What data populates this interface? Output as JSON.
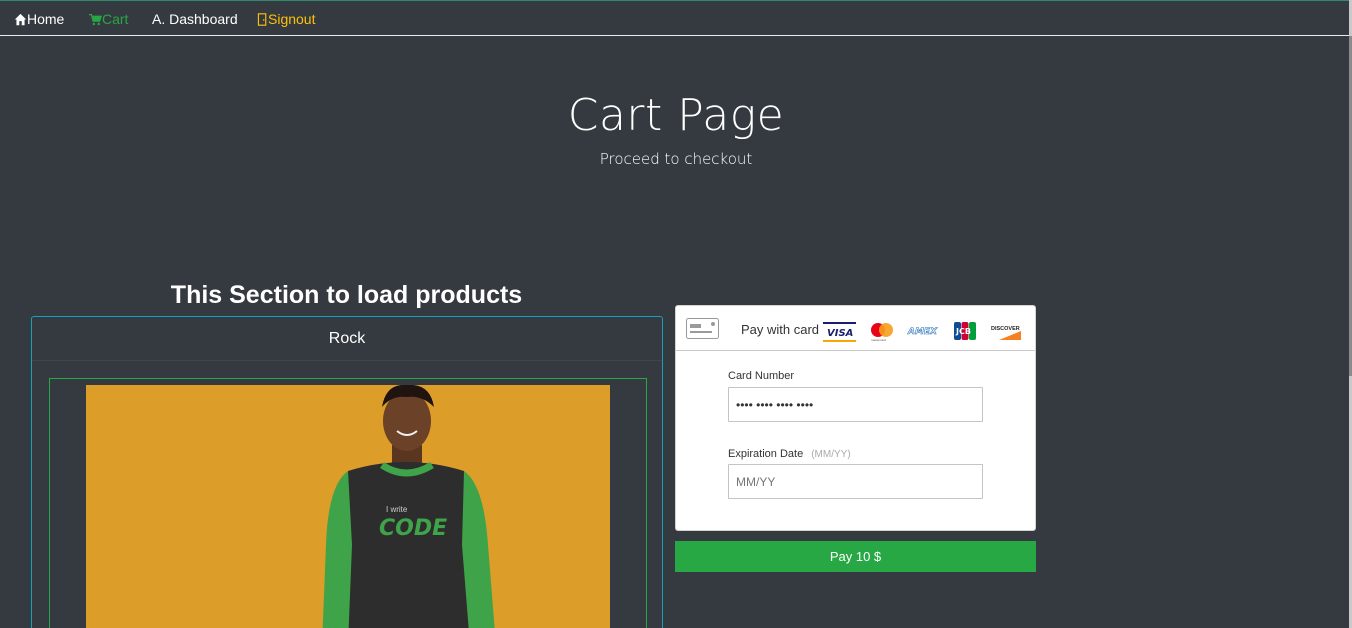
{
  "nav": {
    "home": "Home",
    "cart": "Cart",
    "dashboard": "A. Dashboard",
    "signout": "Signout"
  },
  "hero": {
    "title": "Cart Page",
    "subtitle": "Proceed to checkout"
  },
  "products": {
    "heading": "This Section to load products",
    "items": [
      {
        "name": "Rock",
        "image_text_top": "I write",
        "image_text_main": "CODE"
      }
    ]
  },
  "payment": {
    "pay_with_card": "Pay with card",
    "brands": [
      "VISA",
      "mastercard",
      "AMEX",
      "JCB",
      "DISCOVER"
    ],
    "card_number_label": "Card Number",
    "card_number_value": "•••• •••• •••• ••••",
    "expiration_label": "Expiration Date",
    "expiration_hint": "(MM/YY)",
    "expiration_placeholder": "MM/YY",
    "pay_button": "Pay 10 $"
  },
  "colors": {
    "background": "#343a40",
    "success": "#28a745",
    "warning": "#ffc107",
    "info": "#17a2b8"
  }
}
